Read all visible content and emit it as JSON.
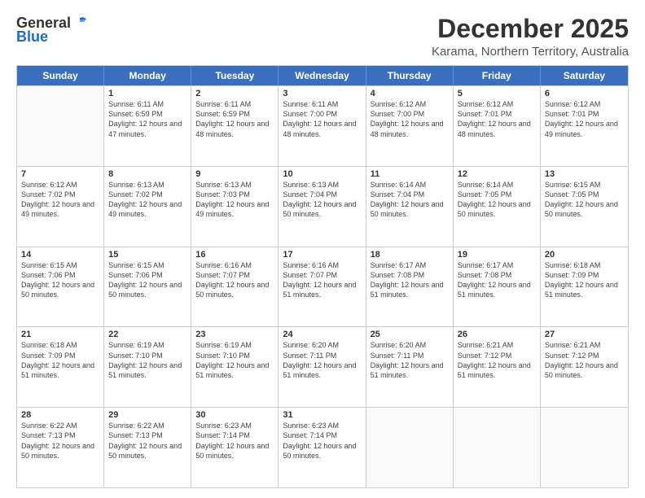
{
  "header": {
    "logo_general": "General",
    "logo_blue": "Blue",
    "main_title": "December 2025",
    "subtitle": "Karama, Northern Territory, Australia"
  },
  "days_of_week": [
    "Sunday",
    "Monday",
    "Tuesday",
    "Wednesday",
    "Thursday",
    "Friday",
    "Saturday"
  ],
  "weeks": [
    [
      {
        "day": "",
        "empty": true
      },
      {
        "day": "1",
        "sunrise": "Sunrise: 6:11 AM",
        "sunset": "Sunset: 6:59 PM",
        "daylight": "Daylight: 12 hours and 47 minutes."
      },
      {
        "day": "2",
        "sunrise": "Sunrise: 6:11 AM",
        "sunset": "Sunset: 6:59 PM",
        "daylight": "Daylight: 12 hours and 48 minutes."
      },
      {
        "day": "3",
        "sunrise": "Sunrise: 6:11 AM",
        "sunset": "Sunset: 7:00 PM",
        "daylight": "Daylight: 12 hours and 48 minutes."
      },
      {
        "day": "4",
        "sunrise": "Sunrise: 6:12 AM",
        "sunset": "Sunset: 7:00 PM",
        "daylight": "Daylight: 12 hours and 48 minutes."
      },
      {
        "day": "5",
        "sunrise": "Sunrise: 6:12 AM",
        "sunset": "Sunset: 7:01 PM",
        "daylight": "Daylight: 12 hours and 48 minutes."
      },
      {
        "day": "6",
        "sunrise": "Sunrise: 6:12 AM",
        "sunset": "Sunset: 7:01 PM",
        "daylight": "Daylight: 12 hours and 49 minutes."
      }
    ],
    [
      {
        "day": "7",
        "sunrise": "Sunrise: 6:12 AM",
        "sunset": "Sunset: 7:02 PM",
        "daylight": "Daylight: 12 hours and 49 minutes."
      },
      {
        "day": "8",
        "sunrise": "Sunrise: 6:13 AM",
        "sunset": "Sunset: 7:02 PM",
        "daylight": "Daylight: 12 hours and 49 minutes."
      },
      {
        "day": "9",
        "sunrise": "Sunrise: 6:13 AM",
        "sunset": "Sunset: 7:03 PM",
        "daylight": "Daylight: 12 hours and 49 minutes."
      },
      {
        "day": "10",
        "sunrise": "Sunrise: 6:13 AM",
        "sunset": "Sunset: 7:04 PM",
        "daylight": "Daylight: 12 hours and 50 minutes."
      },
      {
        "day": "11",
        "sunrise": "Sunrise: 6:14 AM",
        "sunset": "Sunset: 7:04 PM",
        "daylight": "Daylight: 12 hours and 50 minutes."
      },
      {
        "day": "12",
        "sunrise": "Sunrise: 6:14 AM",
        "sunset": "Sunset: 7:05 PM",
        "daylight": "Daylight: 12 hours and 50 minutes."
      },
      {
        "day": "13",
        "sunrise": "Sunrise: 6:15 AM",
        "sunset": "Sunset: 7:05 PM",
        "daylight": "Daylight: 12 hours and 50 minutes."
      }
    ],
    [
      {
        "day": "14",
        "sunrise": "Sunrise: 6:15 AM",
        "sunset": "Sunset: 7:06 PM",
        "daylight": "Daylight: 12 hours and 50 minutes."
      },
      {
        "day": "15",
        "sunrise": "Sunrise: 6:15 AM",
        "sunset": "Sunset: 7:06 PM",
        "daylight": "Daylight: 12 hours and 50 minutes."
      },
      {
        "day": "16",
        "sunrise": "Sunrise: 6:16 AM",
        "sunset": "Sunset: 7:07 PM",
        "daylight": "Daylight: 12 hours and 50 minutes."
      },
      {
        "day": "17",
        "sunrise": "Sunrise: 6:16 AM",
        "sunset": "Sunset: 7:07 PM",
        "daylight": "Daylight: 12 hours and 51 minutes."
      },
      {
        "day": "18",
        "sunrise": "Sunrise: 6:17 AM",
        "sunset": "Sunset: 7:08 PM",
        "daylight": "Daylight: 12 hours and 51 minutes."
      },
      {
        "day": "19",
        "sunrise": "Sunrise: 6:17 AM",
        "sunset": "Sunset: 7:08 PM",
        "daylight": "Daylight: 12 hours and 51 minutes."
      },
      {
        "day": "20",
        "sunrise": "Sunrise: 6:18 AM",
        "sunset": "Sunset: 7:09 PM",
        "daylight": "Daylight: 12 hours and 51 minutes."
      }
    ],
    [
      {
        "day": "21",
        "sunrise": "Sunrise: 6:18 AM",
        "sunset": "Sunset: 7:09 PM",
        "daylight": "Daylight: 12 hours and 51 minutes."
      },
      {
        "day": "22",
        "sunrise": "Sunrise: 6:19 AM",
        "sunset": "Sunset: 7:10 PM",
        "daylight": "Daylight: 12 hours and 51 minutes."
      },
      {
        "day": "23",
        "sunrise": "Sunrise: 6:19 AM",
        "sunset": "Sunset: 7:10 PM",
        "daylight": "Daylight: 12 hours and 51 minutes."
      },
      {
        "day": "24",
        "sunrise": "Sunrise: 6:20 AM",
        "sunset": "Sunset: 7:11 PM",
        "daylight": "Daylight: 12 hours and 51 minutes."
      },
      {
        "day": "25",
        "sunrise": "Sunrise: 6:20 AM",
        "sunset": "Sunset: 7:11 PM",
        "daylight": "Daylight: 12 hours and 51 minutes."
      },
      {
        "day": "26",
        "sunrise": "Sunrise: 6:21 AM",
        "sunset": "Sunset: 7:12 PM",
        "daylight": "Daylight: 12 hours and 51 minutes."
      },
      {
        "day": "27",
        "sunrise": "Sunrise: 6:21 AM",
        "sunset": "Sunset: 7:12 PM",
        "daylight": "Daylight: 12 hours and 50 minutes."
      }
    ],
    [
      {
        "day": "28",
        "sunrise": "Sunrise: 6:22 AM",
        "sunset": "Sunset: 7:13 PM",
        "daylight": "Daylight: 12 hours and 50 minutes."
      },
      {
        "day": "29",
        "sunrise": "Sunrise: 6:22 AM",
        "sunset": "Sunset: 7:13 PM",
        "daylight": "Daylight: 12 hours and 50 minutes."
      },
      {
        "day": "30",
        "sunrise": "Sunrise: 6:23 AM",
        "sunset": "Sunset: 7:14 PM",
        "daylight": "Daylight: 12 hours and 50 minutes."
      },
      {
        "day": "31",
        "sunrise": "Sunrise: 6:23 AM",
        "sunset": "Sunset: 7:14 PM",
        "daylight": "Daylight: 12 hours and 50 minutes."
      },
      {
        "day": "",
        "empty": true
      },
      {
        "day": "",
        "empty": true
      },
      {
        "day": "",
        "empty": true
      }
    ]
  ]
}
